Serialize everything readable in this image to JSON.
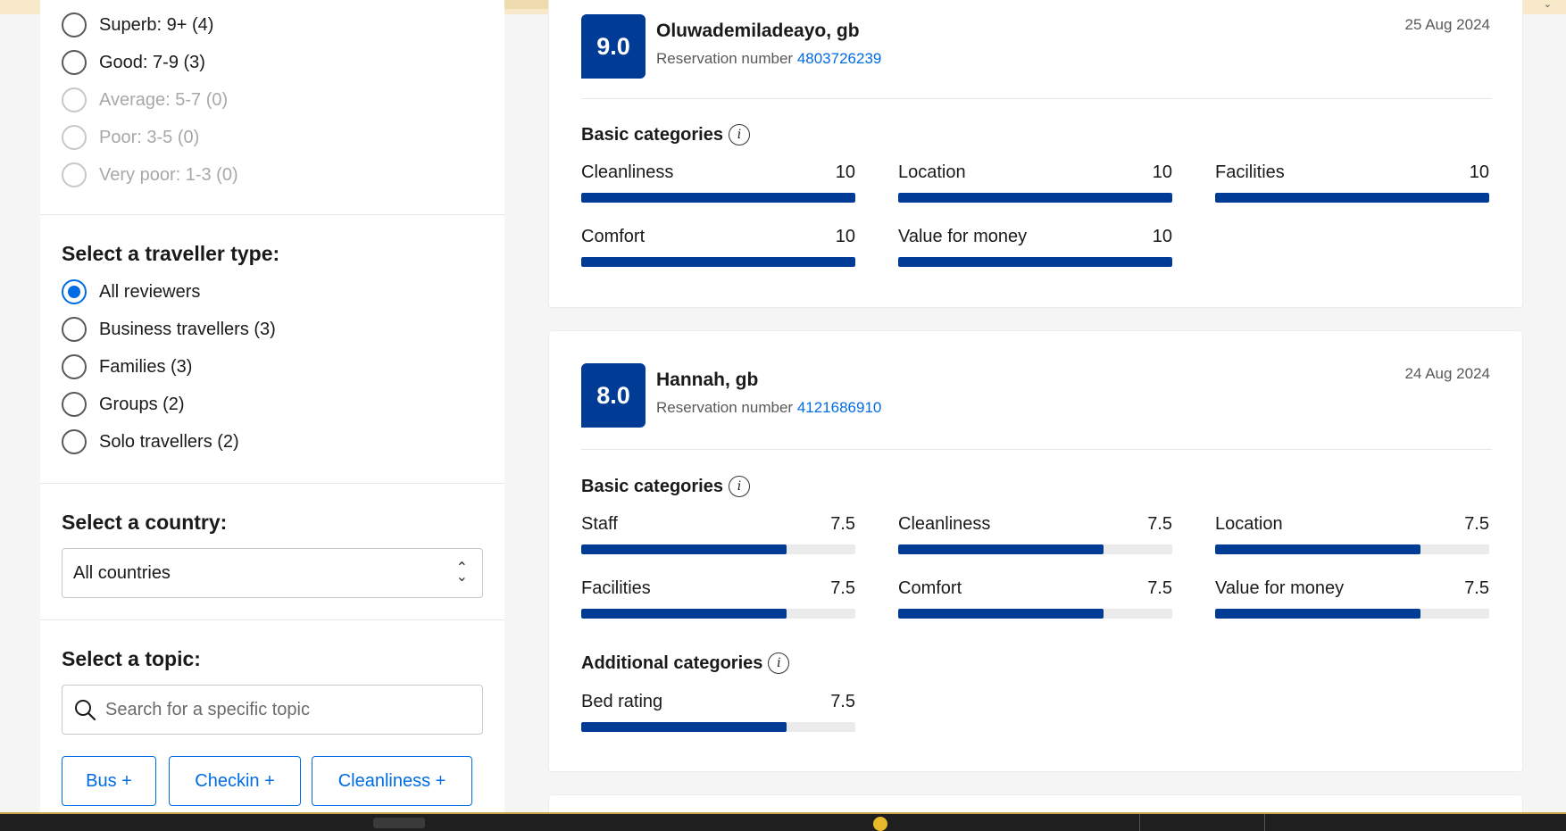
{
  "score_filters": [
    {
      "label": "Superb: 9+ (4)",
      "disabled": false
    },
    {
      "label": "Good: 7-9 (3)",
      "disabled": false
    },
    {
      "label": "Average: 5-7 (0)",
      "disabled": true
    },
    {
      "label": "Poor: 3-5 (0)",
      "disabled": true
    },
    {
      "label": "Very poor: 1-3 (0)",
      "disabled": true
    }
  ],
  "traveller": {
    "title": "Select a traveller type:",
    "options": [
      {
        "label": "All reviewers",
        "checked": true
      },
      {
        "label": "Business travellers (3)",
        "checked": false
      },
      {
        "label": "Families (3)",
        "checked": false
      },
      {
        "label": "Groups (2)",
        "checked": false
      },
      {
        "label": "Solo travellers (2)",
        "checked": false
      }
    ]
  },
  "country": {
    "title": "Select a country:",
    "value": "All countries"
  },
  "topic": {
    "title": "Select a topic:",
    "placeholder": "Search for a specific topic",
    "buttons": [
      "Bus +",
      "Checkin +",
      "Cleanliness +"
    ]
  },
  "reviews": [
    {
      "score": "9.0",
      "name": "Oluwademiladeayo, gb",
      "reservation_label": "Reservation number",
      "reservation_number": "4803726239",
      "date": "25 Aug 2024",
      "basic_title": "Basic categories",
      "basic": [
        {
          "label": "Cleanliness",
          "value": "10",
          "fraction": 1.0
        },
        {
          "label": "Location",
          "value": "10",
          "fraction": 1.0
        },
        {
          "label": "Facilities",
          "value": "10",
          "fraction": 1.0
        },
        {
          "label": "Comfort",
          "value": "10",
          "fraction": 1.0
        },
        {
          "label": "Value for money",
          "value": "10",
          "fraction": 1.0
        }
      ]
    },
    {
      "score": "8.0",
      "name": "Hannah, gb",
      "reservation_label": "Reservation number",
      "reservation_number": "4121686910",
      "date": "24 Aug 2024",
      "basic_title": "Basic categories",
      "basic": [
        {
          "label": "Staff",
          "value": "7.5",
          "fraction": 0.75
        },
        {
          "label": "Cleanliness",
          "value": "7.5",
          "fraction": 0.75
        },
        {
          "label": "Location",
          "value": "7.5",
          "fraction": 0.75
        },
        {
          "label": "Facilities",
          "value": "7.5",
          "fraction": 0.75
        },
        {
          "label": "Comfort",
          "value": "7.5",
          "fraction": 0.75
        },
        {
          "label": "Value for money",
          "value": "7.5",
          "fraction": 0.75
        }
      ],
      "additional_title": "Additional categories",
      "additional": [
        {
          "label": "Bed rating",
          "value": "7.5",
          "fraction": 0.75
        }
      ]
    }
  ],
  "colors": {
    "brand_dark": "#003b95",
    "link": "#006ce4"
  }
}
